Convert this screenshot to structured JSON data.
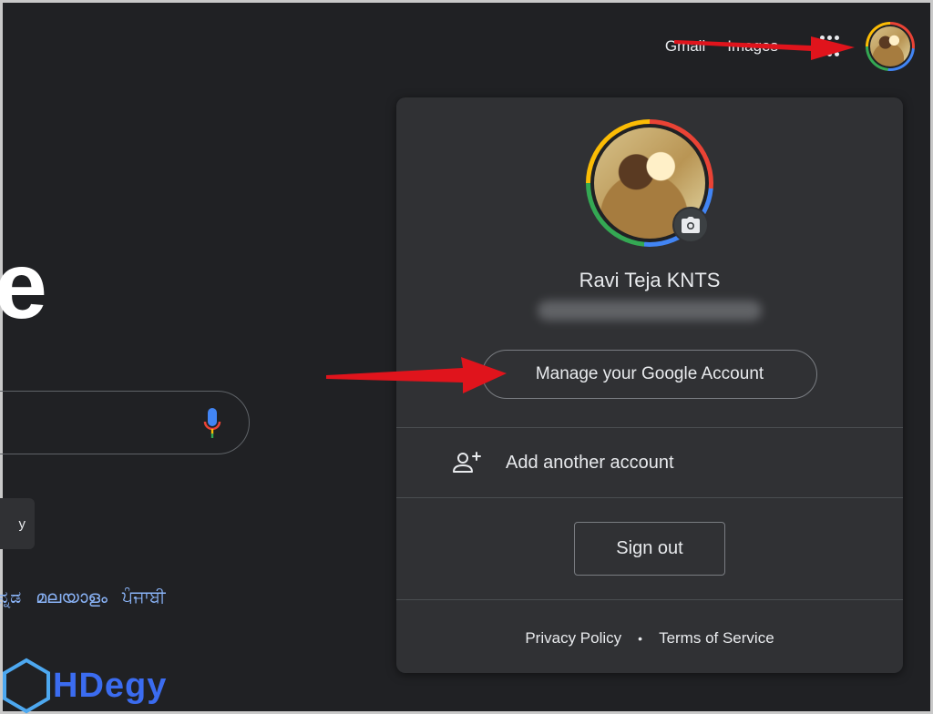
{
  "topbar": {
    "gmail_label": "Gmail",
    "images_label": "Images",
    "apps_icon": "apps-grid-icon"
  },
  "background": {
    "logo_fragment": "e",
    "search_button_fragment": "y",
    "languages": [
      "ನ್ನಡ",
      "മലയാളം",
      "ਪੰਜਾਬੀ"
    ]
  },
  "account_panel": {
    "name": "Ravi Teja KNTS",
    "manage_label": "Manage your Google Account",
    "add_account_label": "Add another account",
    "sign_out_label": "Sign out",
    "privacy_label": "Privacy Policy",
    "footer_separator": "•",
    "terms_label": "Terms of Service"
  },
  "watermark": {
    "text": "HDegy"
  },
  "colors": {
    "background": "#202124",
    "panel": "#303134",
    "link": "#8ab4f8",
    "arrow": "#e0141c",
    "watermark": "#3b6cf0"
  }
}
